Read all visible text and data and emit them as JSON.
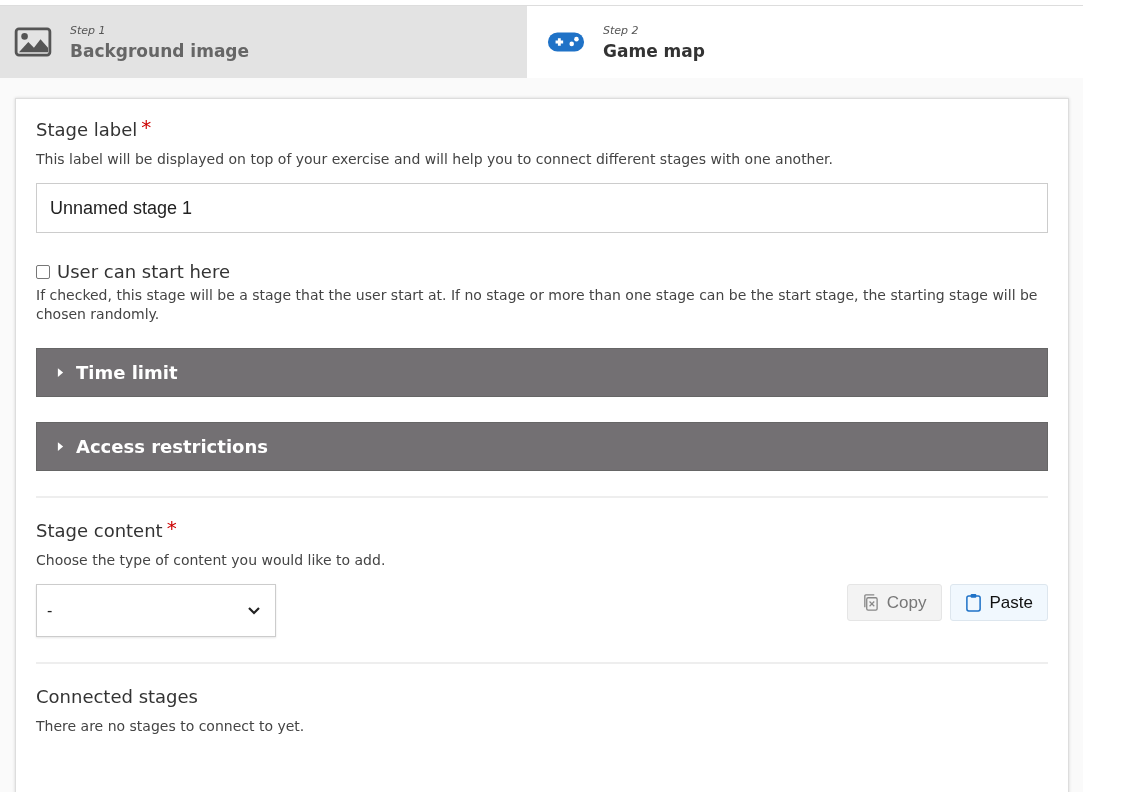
{
  "steps": [
    {
      "step": "Step 1",
      "label": "Background image",
      "kind": "image",
      "selected": false
    },
    {
      "step": "Step 2",
      "label": "Game map",
      "kind": "gamepad",
      "selected": true
    }
  ],
  "stage_label": {
    "label": "Stage label",
    "required_mark": "*",
    "description": "This label will be displayed on top of your exercise and will help you to connect different stages with one another.",
    "value": "Unnamed stage 1"
  },
  "start_here": {
    "label": "User can start here",
    "checked": false,
    "description": "If checked, this stage will be a stage that the user start at. If no stage or more than one stage can be the start stage, the starting stage will be chosen randomly."
  },
  "sections": [
    {
      "label": "Time limit",
      "expanded": false
    },
    {
      "label": "Access restrictions",
      "expanded": false
    }
  ],
  "stage_content": {
    "label": "Stage content",
    "required_mark": "*",
    "description": "Choose the type of content you would like to add.",
    "select_value": "-",
    "buttons": [
      {
        "label": "Copy",
        "kind": "copy",
        "disabled": true
      },
      {
        "label": "Paste",
        "kind": "paste",
        "disabled": false
      }
    ]
  },
  "connected_stages": {
    "label": "Connected stages",
    "description": "There are no stages to connect to yet."
  }
}
